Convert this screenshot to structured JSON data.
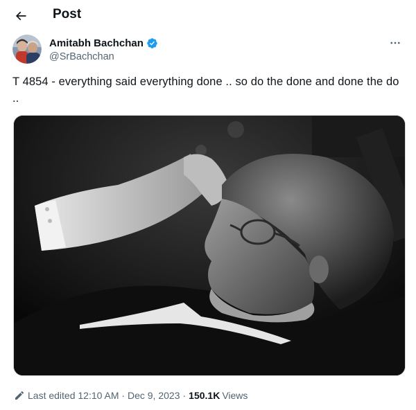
{
  "header": {
    "title": "Post",
    "back_icon": "arrow-left-icon"
  },
  "author": {
    "display_name": "Amitabh Bachchan",
    "handle": "@SrBachchan",
    "verified": true,
    "verified_color": "#1d9bf0"
  },
  "more_icon": "more-horizontal-icon",
  "tweet": {
    "text": "T 4854 - everything said everything done .. so do the done and done the do .."
  },
  "media": {
    "type": "photo",
    "color_mode": "black-and-white"
  },
  "meta": {
    "edit_icon": "pencil-icon",
    "last_edited_label": "Last edited 12:10 AM · Dec 9, 2023",
    "separator": "·",
    "views_count": "150.1K",
    "views_label": "Views"
  },
  "colors": {
    "text_primary": "#0f1419",
    "text_secondary": "#536471",
    "border": "#cfd9de"
  }
}
